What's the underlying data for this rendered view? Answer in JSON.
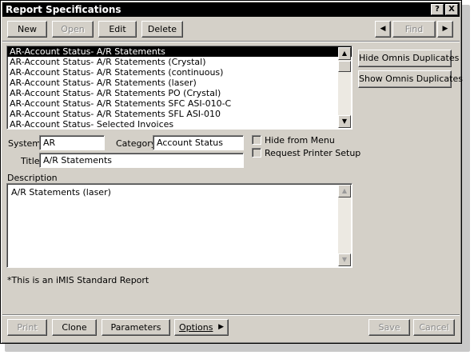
{
  "window": {
    "title": "Report Specifications",
    "help_label": "?",
    "close_label": "X"
  },
  "toolbar": {
    "new_label": "New",
    "open_label": "Open",
    "edit_label": "Edit",
    "delete_label": "Delete",
    "prev_label": "◀",
    "find_label": "Find",
    "next_label": "▶"
  },
  "report_list": [
    "AR-Account Status- A/R Statements",
    "AR-Account Status- A/R Statements (Crystal)",
    "AR-Account Status- A/R Statements (continuous)",
    "AR-Account Status- A/R Statements (laser)",
    "AR-Account Status- A/R Statements PO (Crystal)",
    "AR-Account Status- A/R Statements SFC  ASI-010-C",
    "AR-Account Status- A/R Statements SFL  ASI-010",
    "AR-Account Status- Selected Invoices"
  ],
  "selected_index": 0,
  "side": {
    "hide_dup_label": "Hide Omnis Duplicates",
    "show_dup_label": "Show Omnis Duplicates"
  },
  "form": {
    "system_label": "System",
    "system_value": "AR",
    "category_label": "Category",
    "category_value": "Account Status",
    "title_label": "Title",
    "title_value": "A/R Statements",
    "hide_menu_label": "Hide from Menu",
    "request_printer_label": "Request Printer Setup",
    "description_label": "Description",
    "description_value": "A/R Statements (laser)",
    "standard_note": "*This is an iMIS Standard Report"
  },
  "footer": {
    "print_label": "Print",
    "clone_label": "Clone",
    "parameters_label": "Parameters",
    "options_label": "Options",
    "options_arrow": "▶",
    "save_label": "Save",
    "cancel_label": "Cancel"
  }
}
